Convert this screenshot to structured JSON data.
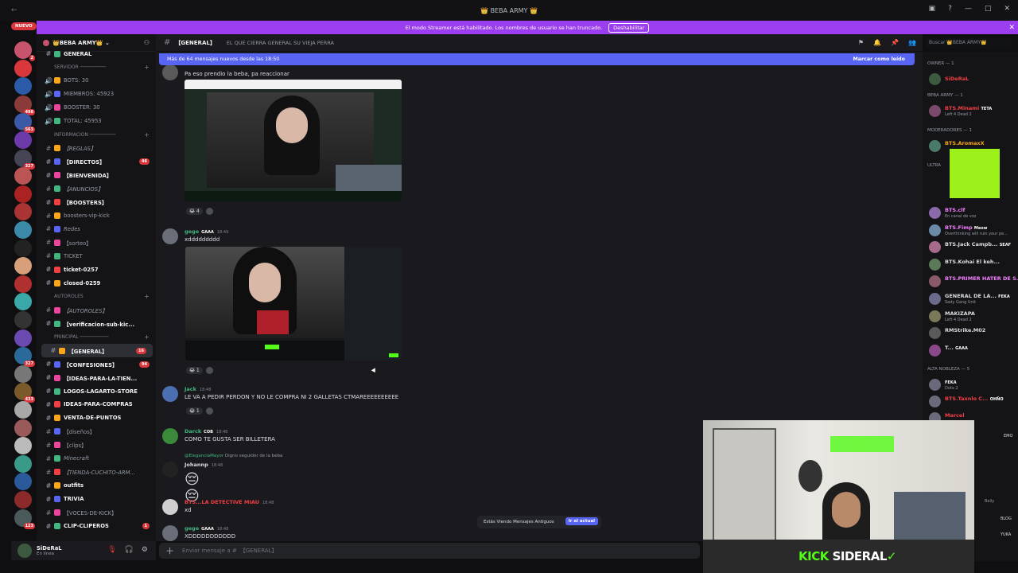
{
  "titlebar": {
    "title": "BEBA ARMY"
  },
  "banner": {
    "text": "El modo Streamer está habilitado. Los nombres de usuario se han truncado.",
    "button": "Deshabilitar"
  },
  "new_badge": "NUEVO",
  "server": {
    "name": "BEBA ARMY"
  },
  "channels": [
    {
      "label": "GENERAL",
      "type": "text",
      "style": "bold"
    },
    {
      "label": "SERVIDOR ─────────",
      "type": "category"
    },
    {
      "label": "BOTS: 30",
      "type": "stat"
    },
    {
      "label": "MIEMBROS: 45923",
      "type": "stat"
    },
    {
      "label": "BOOSTER: 30",
      "type": "stat"
    },
    {
      "label": "TOTAL: 45953",
      "type": "stat"
    },
    {
      "label": "INFORMACION ─────────",
      "type": "category"
    },
    {
      "label": "【REGLAS】",
      "type": "text",
      "style": "italic"
    },
    {
      "label": "【DIRECTOS】",
      "type": "text",
      "style": "bold",
      "badge": "46"
    },
    {
      "label": "【BIENVENIDA】",
      "type": "text",
      "style": "bold"
    },
    {
      "label": "【ANUNCIOS】",
      "type": "text",
      "style": "italic"
    },
    {
      "label": "【BOOSTERS】",
      "type": "text",
      "style": "bold"
    },
    {
      "label": "boosters-vip-kick",
      "type": "text"
    },
    {
      "label": "Redes",
      "type": "text",
      "style": "italic"
    },
    {
      "label": "【sorteo】",
      "type": "text"
    },
    {
      "label": "TICKET",
      "type": "text"
    },
    {
      "label": "ticket-0257",
      "type": "text",
      "style": "bold"
    },
    {
      "label": "closed-0259",
      "type": "text",
      "style": "bold"
    },
    {
      "label": "AUTOROLES",
      "type": "category"
    },
    {
      "label": "【AUTOROLES】",
      "type": "text",
      "style": "italic"
    },
    {
      "label": "【verificacion-sub-kic...",
      "type": "text",
      "style": "bold"
    },
    {
      "label": "PRINCIPAL ──────────",
      "type": "category"
    },
    {
      "label": "【GENERAL】",
      "type": "text",
      "style": "selected",
      "badge": "16"
    },
    {
      "label": "【CONFESIONES】",
      "type": "text",
      "style": "bold",
      "badge": "94"
    },
    {
      "label": "【IDEAS-PARA-LA-TIEN...",
      "type": "text",
      "style": "bold"
    },
    {
      "label": "LOGOS-LAGARTO-STORE",
      "type": "text",
      "style": "bold"
    },
    {
      "label": "IDEAS-PARA-COMPRAS",
      "type": "text",
      "style": "bold"
    },
    {
      "label": "VENTA-DE-PUNTOS",
      "type": "text",
      "style": "bold"
    },
    {
      "label": "【diseños】",
      "type": "text"
    },
    {
      "label": "【clips】",
      "type": "text"
    },
    {
      "label": "Minecraft",
      "type": "text",
      "style": "italic"
    },
    {
      "label": "【TIENDA-CUCHITO-ARM...",
      "type": "text",
      "style": "italic"
    },
    {
      "label": "outfits",
      "type": "text",
      "style": "bold"
    },
    {
      "label": "TRIVIA",
      "type": "text",
      "style": "bold"
    },
    {
      "label": "【VOCES-DE-KICK】",
      "type": "text"
    },
    {
      "label": "CLIP-CLIPEROS",
      "type": "text",
      "style": "bold",
      "badge": "1"
    }
  ],
  "user": {
    "name": "SiDeRaL",
    "status": "En línea"
  },
  "chat_header": {
    "channel": "【GENERAL】",
    "topic": "EL QUE CIERRA GENERAL SU VIEJA PERRA"
  },
  "search_placeholder": "Buscar 👑BEBA ARMY👑",
  "new_messages": {
    "text": "Más de 64 mensajes nuevos desde las 18:50",
    "mark": "Marcar como leído"
  },
  "messages": [
    {
      "user": "",
      "time": "",
      "text": "Pa eso prendio la beba, pa reaccionar",
      "reaction_count": "4"
    },
    {
      "user": "gege",
      "tag": "GAAA",
      "time": "18:49",
      "text": "xddddddddd",
      "reaction_count": "1"
    },
    {
      "user": "Jack",
      "tag": "",
      "time": "18:48",
      "text": "LE VA A PEDIR PERDON Y NO LE COMPRA NI 2 GALLETAS CTMAREEEEEEEEEE",
      "reaction_count": "1"
    },
    {
      "user": "Darck",
      "tag": "COB",
      "time": "18:48",
      "text": "COMO TE GUSTA SER BILLETERA"
    },
    {
      "user": "Johannp",
      "reply_user": "@EleganciaMayor",
      "reply_text": "Digno seguidor de la beba",
      "time": "18:48",
      "text": ""
    },
    {
      "user": "BTS...LA DETECTIVE MIAU",
      "time": "18:48",
      "text": "xd"
    },
    {
      "user": "gege",
      "tag": "GAAA",
      "time": "18:48",
      "text": "XDDDDDDDDDDD"
    }
  ],
  "old_messages": {
    "text": "Estás Viendo Mensajes Antiguos",
    "button": "Ir al actual"
  },
  "composer": {
    "placeholder": "Enviar mensaje a #",
    "channel": "【GENERAL】"
  },
  "members": {
    "owner_cat": "OWNER — 1",
    "owner": "SiDeRaL",
    "beba_cat": "BEBA ARMY — 1",
    "beba": {
      "name": "BTS.Minami",
      "tag": "TETA",
      "sub": "Left 4 Dead 2"
    },
    "mod_cat": "MODERADORES — 1",
    "mod": "BTS.AromaxX",
    "ultra_cat": "ULTRA",
    "list": [
      {
        "name": "BTS.clf",
        "sub": "En canal de voz",
        "color": "#f47fff"
      },
      {
        "name": "BTS.Fimp",
        "sub": "Overthinking will ruin your pe...",
        "color": "#f47fff",
        "tag": "Meow"
      },
      {
        "name": "BTS.Jack Campb...",
        "sub": "",
        "color": "#dbdee1",
        "tag": "SEAF"
      },
      {
        "name": "BTS.Kohai El keh...",
        "sub": "",
        "color": "#dbdee1"
      },
      {
        "name": "BTS.PRIMER HATER DE S...",
        "sub": "",
        "color": "#f47fff"
      },
      {
        "name": "GENERAL DE LA...",
        "sub": "Sady Gang Unit",
        "color": "#dbdee1",
        "tag": "FEKA"
      },
      {
        "name": "MAKIZAPA",
        "sub": "Left 4 Dead 2",
        "color": "#dbdee1"
      },
      {
        "name": "RMStrike.M02",
        "sub": "",
        "color": "#dbdee1"
      },
      {
        "name": "T...",
        "sub": "",
        "color": "#dbdee1",
        "tag": "GAAA"
      }
    ],
    "nobleza_cat": "ALTA NOBLEZA — 5",
    "nobleza": [
      {
        "name": "",
        "sub": "Dota 2",
        "tag": "FEKA"
      },
      {
        "name": "BTS.Taxnlo C...",
        "sub": "",
        "tag": "OHÑO"
      },
      {
        "name": "Marcel",
        "sub": ""
      }
    ],
    "extra_tags": [
      "EMO",
      "Baily",
      "BLOG",
      "YUKA"
    ]
  },
  "stream": {
    "brand": "KICK",
    "name": "SIDERAL"
  }
}
